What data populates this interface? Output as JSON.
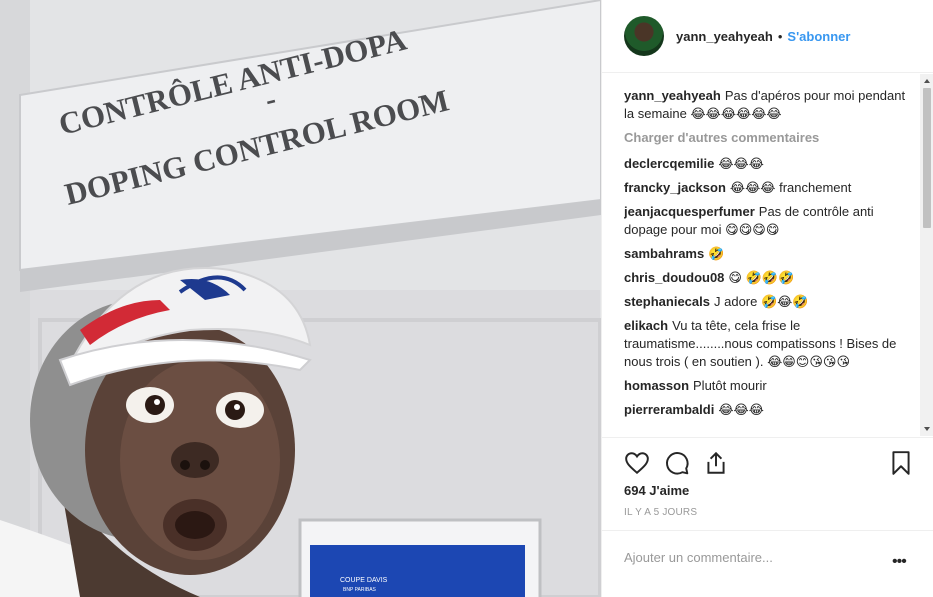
{
  "photo": {
    "sign_line1": "CONTRÔLE ANTI-DOPA",
    "sign_dash": "-",
    "sign_line2": "DOPING CONTROL ROOM",
    "poster_text1": "COUPE DAVIS",
    "poster_text2": "BNP PARIBAS"
  },
  "header": {
    "username": "yann_yeahyeah",
    "separator": "•",
    "follow_label": "S'abonner"
  },
  "caption": {
    "user": "yann_yeahyeah",
    "text": "Pas d'apéros pour moi pendant la semaine 😂😂😂😂😂😂"
  },
  "load_more": "Charger d'autres commentaires",
  "comments": [
    {
      "user": "declercqemilie",
      "text": "😂😂😂"
    },
    {
      "user": "francky_jackson",
      "text": "😂😂😂 franchement"
    },
    {
      "user": "jeanjacquesperfumer",
      "text": "Pas de contrôle anti dopage pour moi 😋😋😋😋"
    },
    {
      "user": "sambahrams",
      "text": "🤣"
    },
    {
      "user": "chris_doudou08",
      "text": "😋 🤣🤣🤣"
    },
    {
      "user": "stephaniecals",
      "text": "J adore 🤣😂🤣"
    },
    {
      "user": "elikach",
      "text": "Vu ta tête, cela frise le traumatisme........nous compatissons ! Bises de nous trois ( en soutien ). 😂😁😊😘😘😘"
    },
    {
      "user": "homasson",
      "text": "Plutôt mourir"
    },
    {
      "user": "pierrerambaldi",
      "text": "😂😂😂"
    }
  ],
  "likes": "694 J'aime",
  "time_ago": "IL Y A 5 JOURS",
  "comment_input": {
    "placeholder": "Ajouter un commentaire...",
    "more": "•••"
  },
  "icons": {
    "like": "heart-icon",
    "comment": "comment-icon",
    "share": "share-icon",
    "save": "bookmark-icon"
  }
}
